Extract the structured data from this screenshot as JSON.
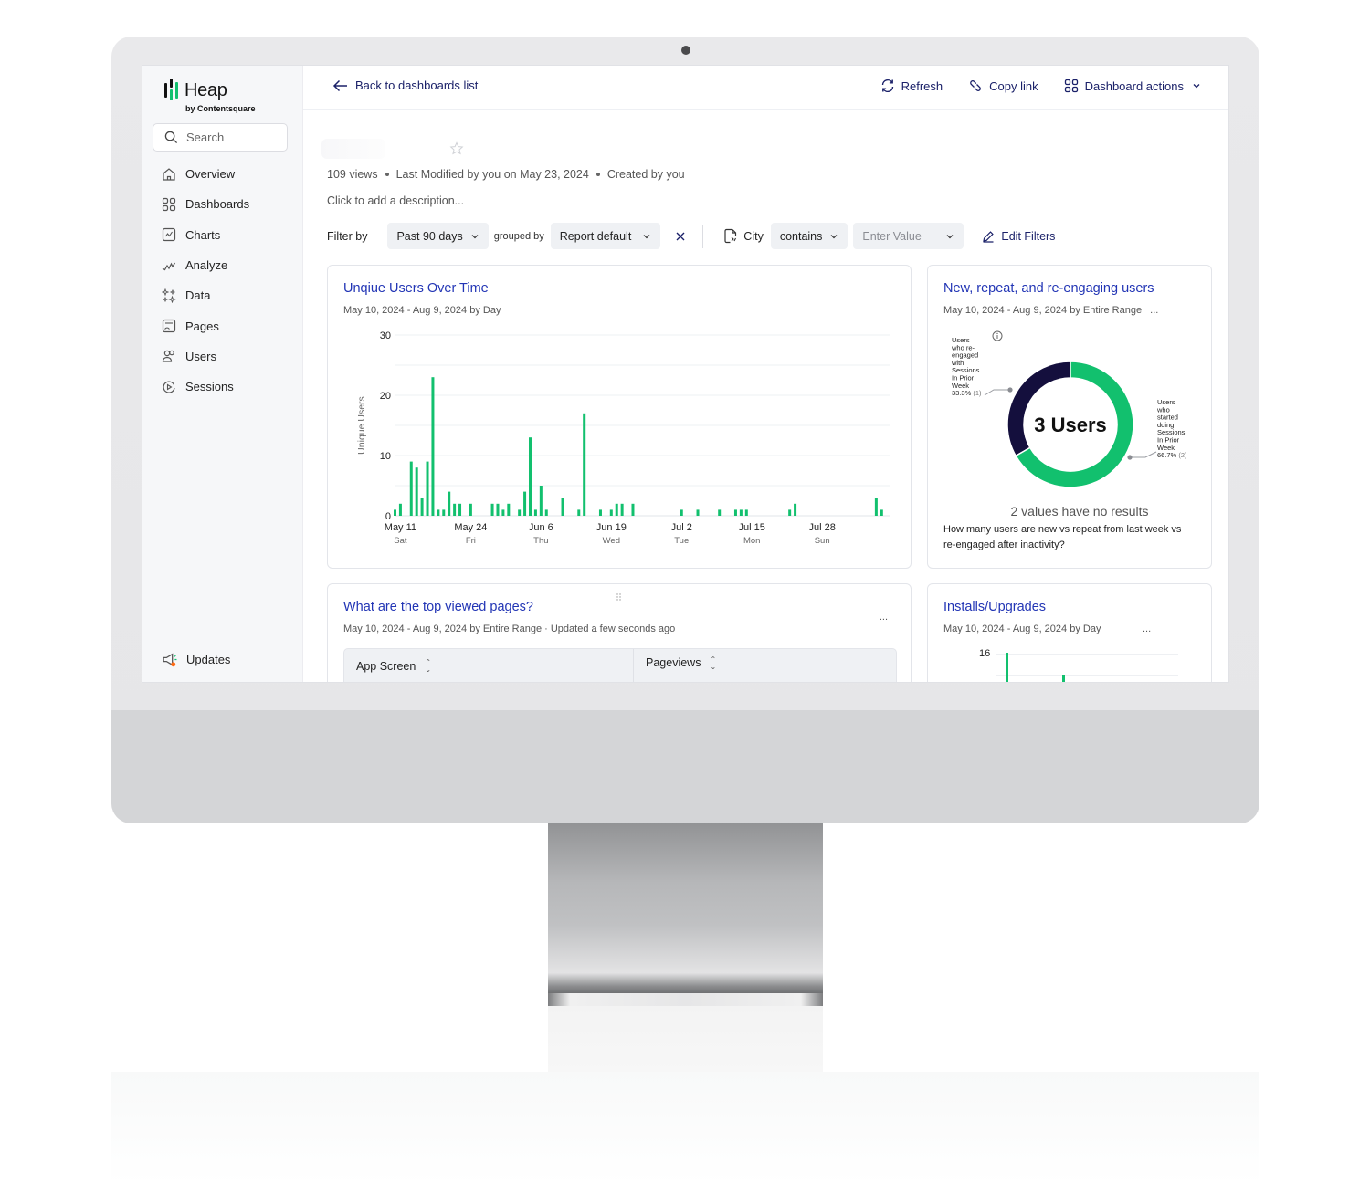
{
  "app": {
    "name": "Heap",
    "byline": "by Contentsquare"
  },
  "colors": {
    "accent_green": "#12c06e",
    "link_blue": "#2235b5",
    "navy": "#1b2169",
    "donut_dark": "#140f3d"
  },
  "sidebar": {
    "search_placeholder": "Search",
    "items": [
      {
        "label": "Overview",
        "icon": "home-icon"
      },
      {
        "label": "Dashboards",
        "icon": "grid-icon"
      },
      {
        "label": "Charts",
        "icon": "chart-icon"
      },
      {
        "label": "Analyze",
        "icon": "analyze-icon"
      },
      {
        "label": "Data",
        "icon": "sparkle-icon"
      },
      {
        "label": "Pages",
        "icon": "pages-icon"
      },
      {
        "label": "Users",
        "icon": "users-icon"
      },
      {
        "label": "Sessions",
        "icon": "sessions-icon"
      }
    ],
    "updates_label": "Updates"
  },
  "topbar": {
    "back_label": "Back to dashboards list",
    "refresh_label": "Refresh",
    "copy_link_label": "Copy link",
    "dashboard_actions_label": "Dashboard actions"
  },
  "dashboard": {
    "views": "109 views",
    "modified": "Last Modified by you on May 23, 2024",
    "created": "Created by you",
    "description_placeholder": "Click to add a description..."
  },
  "filters": {
    "filter_by_label": "Filter by",
    "date_range": "Past 90 days",
    "grouped_by_label": "grouped by",
    "grouping": "Report default",
    "property": "City",
    "operator": "contains",
    "value_placeholder": "Enter Value",
    "edit_filters_label": "Edit Filters"
  },
  "panels": {
    "unique_users": {
      "title": "Unqiue Users Over Time",
      "subtitle": "May 10, 2024 - Aug 9, 2024 by Day"
    },
    "new_repeat": {
      "title": "New, repeat, and re-engaging users",
      "subtitle": "May 10, 2024 - Aug 9, 2024 by Entire Range",
      "more": "...",
      "center_label": "3 Users",
      "no_results": "2 values have no results",
      "description": "How many users are new vs repeat from last week vs re-engaged after inactivity?"
    },
    "top_pages": {
      "title": "What are the top viewed pages?",
      "subtitle": "May 10, 2024 - Aug 9, 2024 by Entire Range · Updated a few seconds ago",
      "more": "...",
      "columns": [
        "App Screen",
        "Pageviews"
      ]
    },
    "installs": {
      "title": "Installs/Upgrades",
      "subtitle": "May 10, 2024 - Aug 9, 2024 by Day",
      "more": "...",
      "y_tick_top": "16"
    }
  },
  "chart_data": [
    {
      "type": "bar",
      "title": "Unqiue Users Over Time",
      "xlabel": "",
      "ylabel": "Unique Users",
      "ylim": [
        0,
        30
      ],
      "yticks": [
        0,
        10,
        20,
        30
      ],
      "grid": true,
      "start_date": "2024-05-10",
      "xticks": [
        {
          "day_index": 1,
          "label": "May 11",
          "sub": "Sat"
        },
        {
          "day_index": 14,
          "label": "May 24",
          "sub": "Fri"
        },
        {
          "day_index": 27,
          "label": "Jun 6",
          "sub": "Thu"
        },
        {
          "day_index": 40,
          "label": "Jun 19",
          "sub": "Wed"
        },
        {
          "day_index": 53,
          "label": "Jul 2",
          "sub": "Tue"
        },
        {
          "day_index": 66,
          "label": "Jul 15",
          "sub": "Mon"
        },
        {
          "day_index": 79,
          "label": "Jul 28",
          "sub": "Sun"
        }
      ],
      "num_days": 92,
      "values": [
        1,
        2,
        0,
        9,
        8,
        3,
        9,
        23,
        1,
        1,
        4,
        2,
        2,
        0,
        2,
        0,
        0,
        0,
        2,
        2,
        1,
        2,
        0,
        1,
        4,
        13,
        1,
        5,
        1,
        0,
        0,
        3,
        0,
        0,
        1,
        17,
        0,
        0,
        1,
        0,
        1,
        2,
        2,
        0,
        2,
        0,
        0,
        0,
        0,
        0,
        0,
        0,
        0,
        1,
        0,
        0,
        1,
        0,
        0,
        0,
        1,
        0,
        0,
        1,
        1,
        1,
        0,
        0,
        0,
        0,
        0,
        0,
        0,
        1,
        2,
        0,
        0,
        0,
        0,
        0,
        0,
        0,
        0,
        0,
        0,
        0,
        0,
        0,
        0,
        3,
        1,
        0
      ]
    },
    {
      "type": "pie",
      "title": "New, repeat, and re-engaging users",
      "center_label": "3 Users",
      "slices": [
        {
          "label": "Users who re-engaged with Sessions In Prior Week",
          "percent": 33.3,
          "count": 1
        },
        {
          "label": "Users who started doing Sessions In Prior Week",
          "percent": 66.7,
          "count": 2
        }
      ]
    }
  ]
}
